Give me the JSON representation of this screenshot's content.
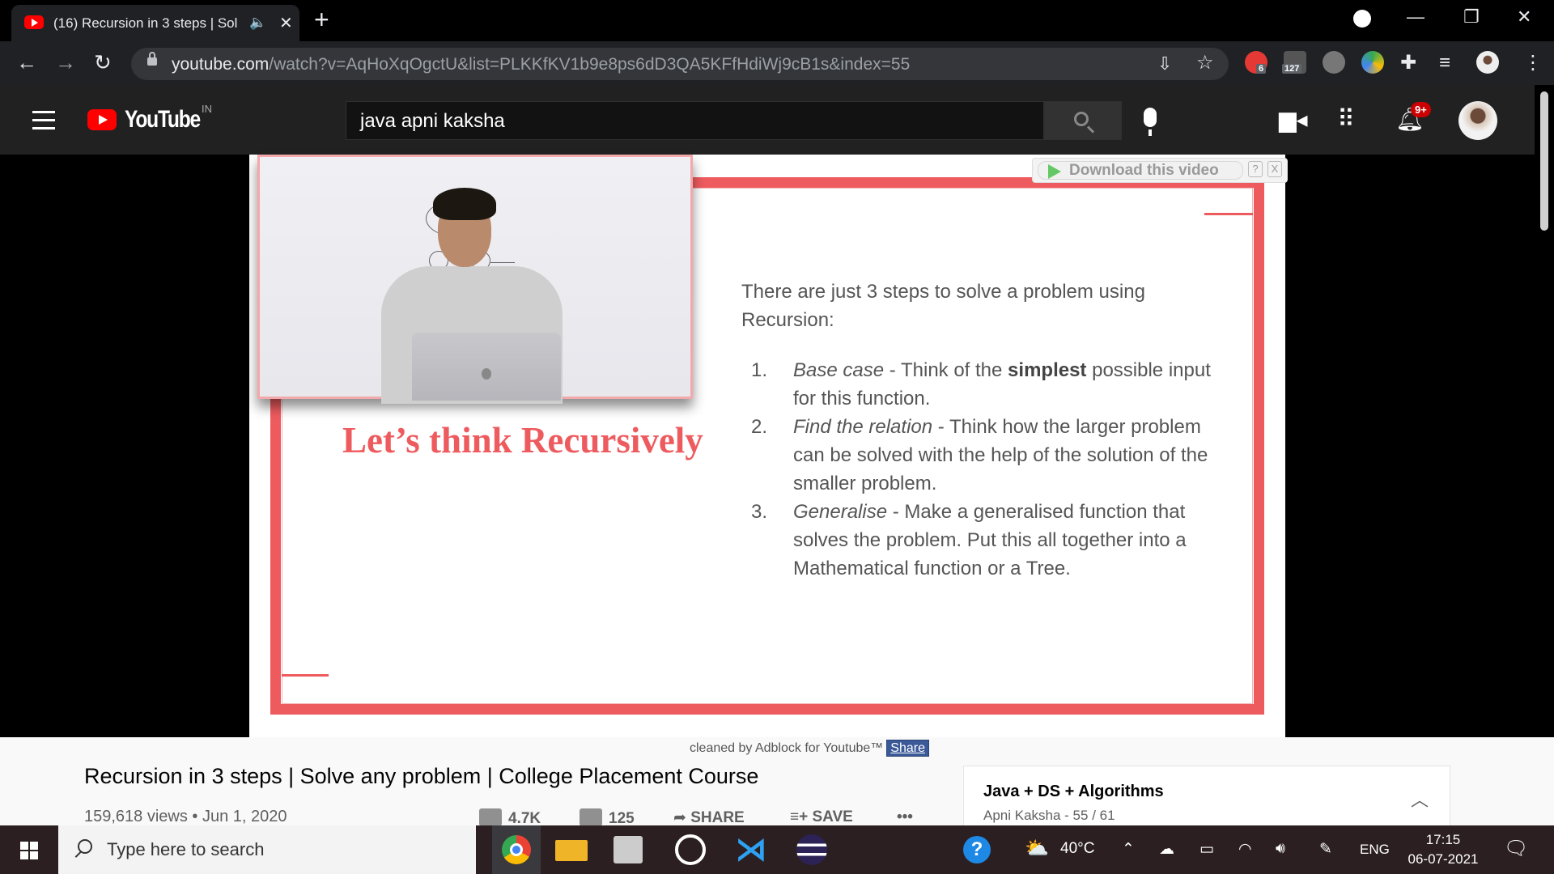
{
  "browser": {
    "tab_title": "(16) Recursion in 3 steps | Sol",
    "tab_audio_icon": "speaker-icon",
    "url_host": "youtube.com",
    "url_rest": "/watch?v=AqHoXqOgctU&list=PLKKfKV1b9e8ps6dD3QA5KFfHdiWj9cB1s&index=55",
    "ext_abp_count": "6",
    "ext_ticket_count": "127"
  },
  "youtube": {
    "logo_text": "YouTube",
    "country_code": "IN",
    "search_value": "java apni kaksha",
    "notification_badge": "9+"
  },
  "video": {
    "download_label": "Download this video",
    "download_help": "?",
    "download_close": "X",
    "slide_headline": "Let’s think Recursively",
    "slide_intro": "There are just 3 steps to solve a problem using Recursion:",
    "steps": [
      {
        "num": "1.",
        "italic": "Base case",
        "pre": " - Think of the ",
        "bold": "simplest",
        "post": " possible input for this function."
      },
      {
        "num": "2.",
        "italic": "Find the relation",
        "pre": "  - Think how the larger problem can be solved with the help of the solution of the smaller problem.",
        "bold": "",
        "post": ""
      },
      {
        "num": "3.",
        "italic": "Generalise",
        "pre": " - Make a generalised function that solves the problem. Put this all together into a Mathematical function or a Tree.",
        "bold": "",
        "post": ""
      }
    ]
  },
  "below": {
    "adblock_text": "cleaned by Adblock for Youtube™",
    "adblock_share": "Share",
    "video_title": "Recursion in 3 steps | Solve any problem | College Placement Course",
    "views_date": "159,618 views • Jun 1, 2020",
    "likes": "4.7K",
    "dislikes": "125",
    "share_label": "SHARE",
    "save_label": "SAVE",
    "more_label": "•••",
    "playlist_title": "Java + DS + Algorithms",
    "playlist_sub": "Apni Kaksha - 55 / 61"
  },
  "taskbar": {
    "search_placeholder": "Type here to search",
    "weather": "40°C",
    "language": "ENG",
    "time": "17:15",
    "date": "06-07-2021"
  }
}
